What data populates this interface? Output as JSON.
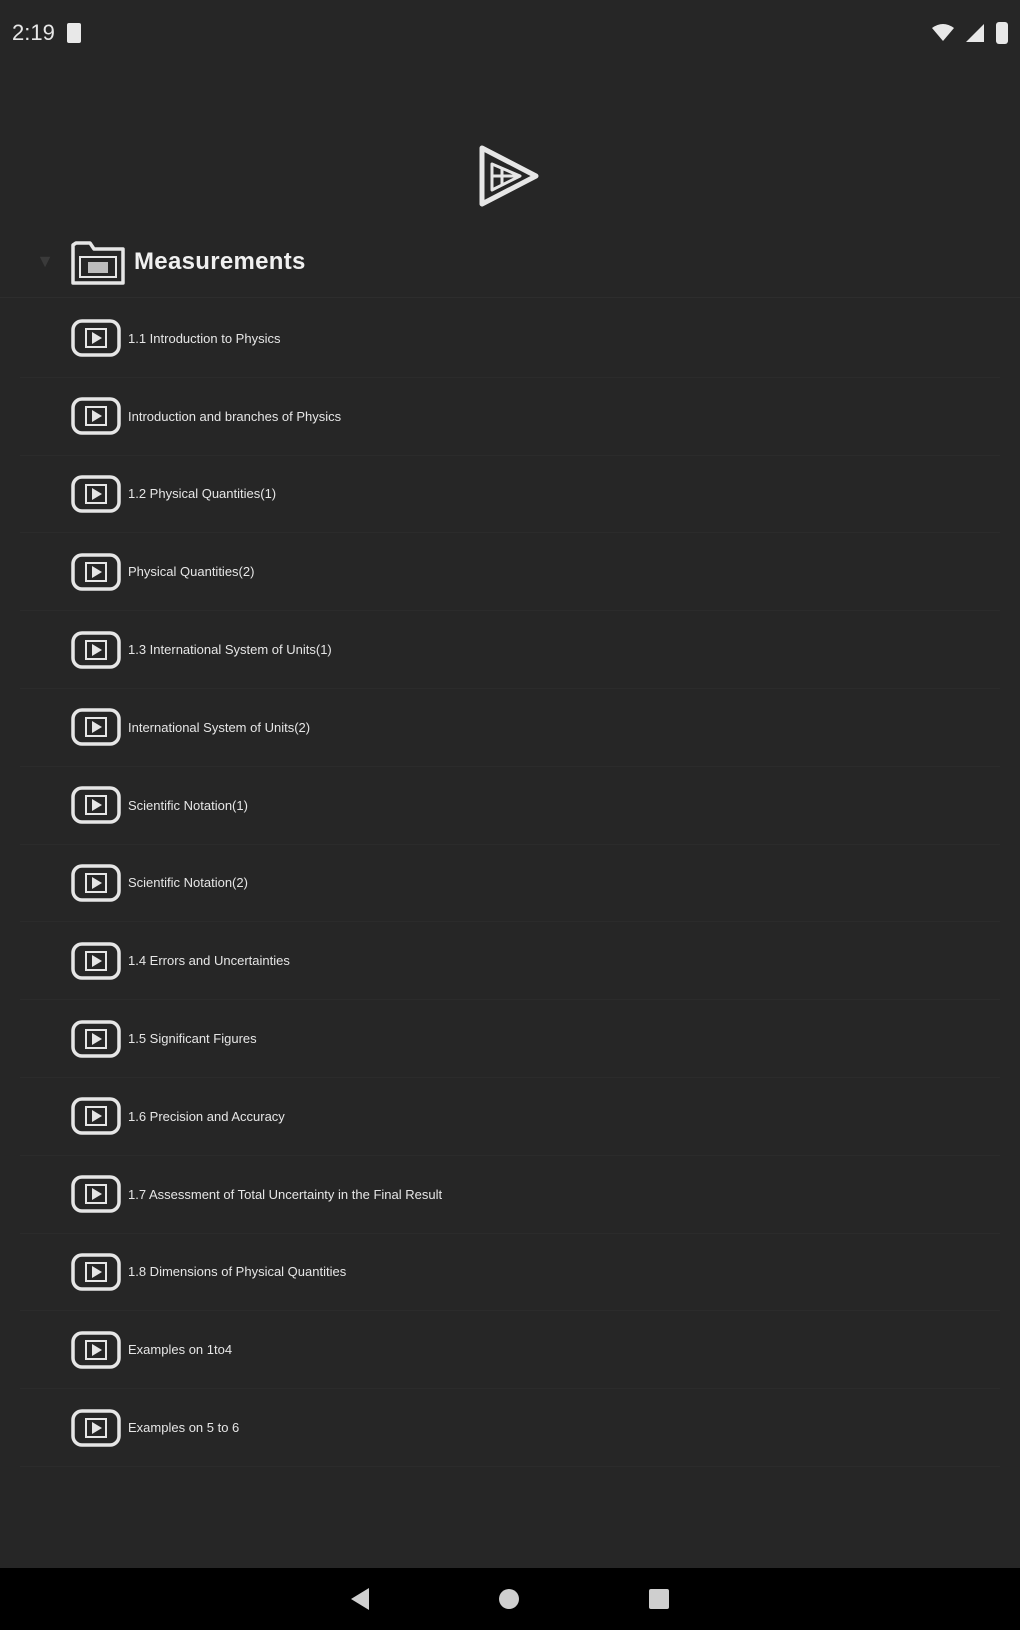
{
  "status_bar": {
    "time": "2:19"
  },
  "header": {
    "title": "Measurements"
  },
  "lessons": [
    {
      "label": "1.1 Introduction to Physics"
    },
    {
      "label": "Introduction and branches of Physics"
    },
    {
      "label": "1.2 Physical Quantities(1)"
    },
    {
      "label": "Physical Quantities(2)"
    },
    {
      "label": "1.3 International System of Units(1)"
    },
    {
      "label": "International System of Units(2)"
    },
    {
      "label": "Scientific Notation(1)"
    },
    {
      "label": "Scientific Notation(2)"
    },
    {
      "label": "1.4 Errors and Uncertainties"
    },
    {
      "label": "1.5 Significant Figures"
    },
    {
      "label": "1.6 Precision and Accuracy"
    },
    {
      "label": "1.7 Assessment of Total Uncertainty in the Final Result"
    },
    {
      "label": "1.8 Dimensions of Physical Quantities"
    },
    {
      "label": "Examples on 1to4"
    },
    {
      "label": "Examples on 5 to 6"
    }
  ],
  "colors": {
    "background": "#262626",
    "nav_bar": "#000000",
    "text": "#e6e6e6"
  }
}
